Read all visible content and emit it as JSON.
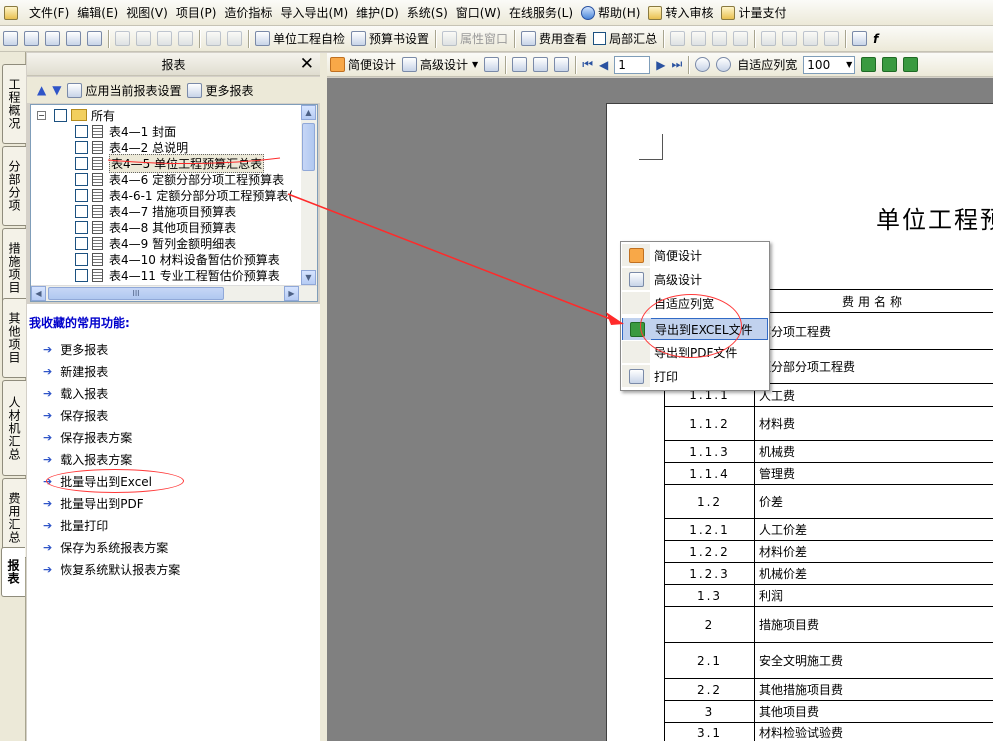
{
  "menubar": {
    "items": [
      "文件(F)",
      "编辑(E)",
      "视图(V)",
      "项目(P)",
      "造价指标",
      "导入导出(M)",
      "维护(D)",
      "系统(S)",
      "窗口(W)",
      "在线服务(L)",
      "帮助(H)",
      "转入审核",
      "计量支付"
    ]
  },
  "toolbar1": {
    "unit_check": "单位工程自检",
    "budget_settings": "预算书设置",
    "property_window": "属性窗口",
    "fee_view": "费用查看",
    "local_summary": "局部汇总"
  },
  "left_panel": {
    "title": "报表",
    "close": "✕",
    "apply_settings": "应用当前报表设置",
    "more_reports": "更多报表"
  },
  "tree": {
    "root": "所有",
    "items": [
      "表4—1 封面",
      "表4—2 总说明",
      "表4—5 单位工程预算汇总表",
      "表4—6 定额分部分项工程预算表",
      "表4-6-1 定额分部分项工程预算表(",
      "表4—7 措施项目预算表",
      "表4—8 其他项目预算表",
      "表4—9 暂列金额明细表",
      "表4—10 材料设备暂估价预算表",
      "表4—11 专业工程暂估价预算表"
    ],
    "hscroll_grip": "III"
  },
  "favorites": {
    "title": "我收藏的常用功能:",
    "items": [
      "更多报表",
      "新建报表",
      "载入报表",
      "保存报表",
      "保存报表方案",
      "载入报表方案",
      "批量导出到Excel",
      "批量导出到PDF",
      "批量打印",
      "保存为系统报表方案",
      "恢复系统默认报表方案"
    ]
  },
  "side_tabs": [
    "工程概况",
    "分部分项",
    "措施项目",
    "其他项目",
    "人材机汇总",
    "费用汇总",
    "报表"
  ],
  "report_toolbar": {
    "simple_design": "简便设计",
    "advanced_design": "高级设计",
    "page_value": "1",
    "auto_fit": "自适应列宽",
    "zoom": "100"
  },
  "context_menu": {
    "items": [
      "简便设计",
      "高级设计",
      "自适应列宽",
      "导出到EXCEL文件",
      "导出到PDF文件",
      "打印"
    ],
    "highlighted_index": 3
  },
  "document": {
    "title": "单位工程预",
    "header_fee_name": "费用名称",
    "rows": [
      {
        "no": "",
        "name": "部分项工程费"
      },
      {
        "no": "",
        "name": "额分部分项工程费"
      },
      {
        "no": "1.1.1",
        "name": "人工费"
      },
      {
        "no": "1.1.2",
        "name": "材料费"
      },
      {
        "no": "1.1.3",
        "name": "机械费"
      },
      {
        "no": "1.1.4",
        "name": "管理费"
      },
      {
        "no": "1.2",
        "name": "价差"
      },
      {
        "no": "1.2.1",
        "name": "人工价差"
      },
      {
        "no": "1.2.2",
        "name": "材料价差"
      },
      {
        "no": "1.2.3",
        "name": "机械价差"
      },
      {
        "no": "1.3",
        "name": "利润"
      },
      {
        "no": "2",
        "name": "措施项目费"
      },
      {
        "no": "2.1",
        "name": "安全文明施工费"
      },
      {
        "no": "2.2",
        "name": "其他措施项目费"
      },
      {
        "no": "3",
        "name": "其他项目费"
      },
      {
        "no": "3.1",
        "name": "材料检验试验费"
      }
    ]
  },
  "annotation": {
    "color": "#ff2a2a"
  }
}
